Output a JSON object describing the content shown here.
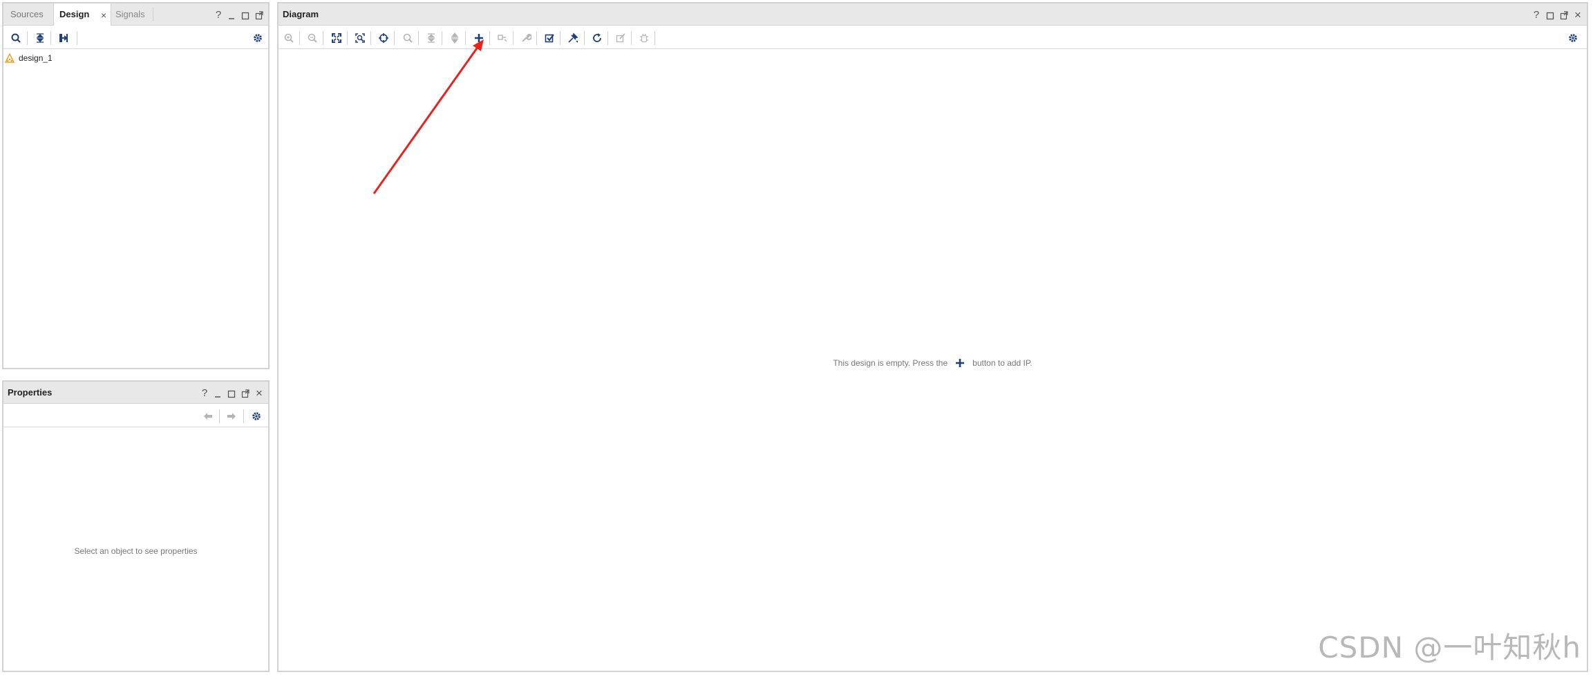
{
  "sources_panel": {
    "tabs": [
      {
        "label": "Sources"
      },
      {
        "label": "Design"
      },
      {
        "label": "Signals"
      }
    ],
    "tree": {
      "item_label": "design_1"
    }
  },
  "properties_panel": {
    "title": "Properties",
    "empty_message": "Select an object to see properties"
  },
  "diagram_panel": {
    "title": "Diagram",
    "empty_message_before": "This design is empty. Press the",
    "empty_message_after": "button to add IP."
  },
  "watermark": "CSDN @一叶知秋h",
  "colors": {
    "accent_blue": "#1f3f7a",
    "disabled_gray": "#b5b5b5",
    "arrow_red": "#e8231f",
    "warning_orange": "#f0a020"
  },
  "icons": {
    "header_controls": [
      "help-icon",
      "minimize-icon",
      "maximize-icon",
      "float-icon",
      "close-icon"
    ],
    "diagram_toolbar": [
      "zoom-in-icon",
      "zoom-out-icon",
      "fit-view-icon",
      "zoom-area-icon",
      "auto-fit-icon",
      "search-icon",
      "collapse-all-icon",
      "expand-all-icon",
      "add-ip-icon",
      "make-connection-icon",
      "properties-wrench-icon",
      "validate-design-icon",
      "run-automation-icon",
      "regenerate-layout-icon",
      "edit-icon",
      "debug-icon",
      "settings-gear-icon"
    ]
  }
}
